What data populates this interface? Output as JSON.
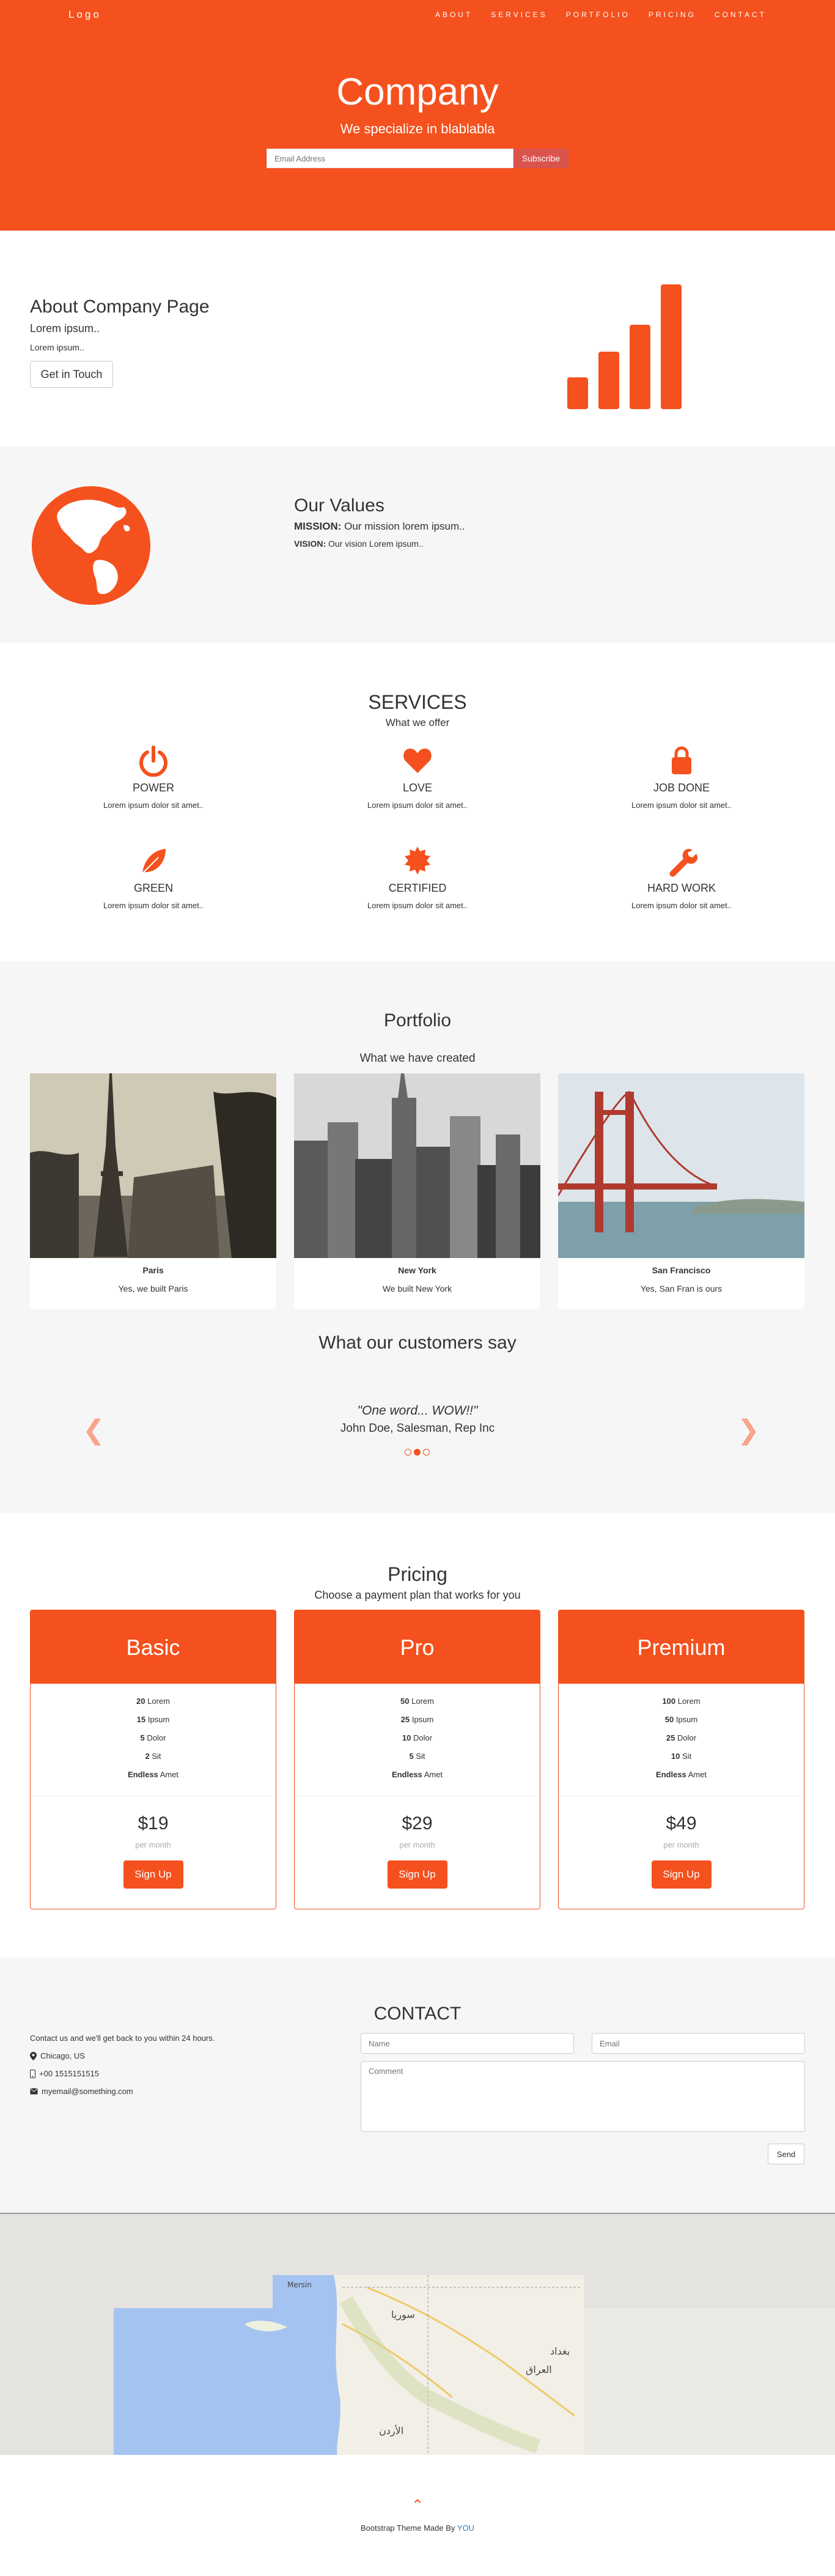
{
  "nav": {
    "logo": "Logo",
    "links": [
      "ABOUT",
      "SERVICES",
      "PORTFOLIO",
      "PRICING",
      "CONTACT"
    ]
  },
  "jumbotron": {
    "title": "Company",
    "tagline": "We specialize in blablabla",
    "email_placeholder": "Email Address",
    "subscribe_label": "Subscribe"
  },
  "about": {
    "title": "About Company Page",
    "lead": "Lorem ipsum..",
    "text": "Lorem ipsum..",
    "button_label": "Get in Touch",
    "icon": "signal-icon"
  },
  "values": {
    "icon": "globe-icon",
    "title": "Our Values",
    "mission_label": "MISSION:",
    "mission_text": " Our mission lorem ipsum..",
    "vision_label": "VISION:",
    "vision_text": " Our vision Lorem ipsum.."
  },
  "services": {
    "title": "SERVICES",
    "subtitle": "What we offer",
    "items": [
      {
        "icon": "power-icon",
        "title": "POWER",
        "text": "Lorem ipsum dolor sit amet.."
      },
      {
        "icon": "heart-icon",
        "title": "LOVE",
        "text": "Lorem ipsum dolor sit amet.."
      },
      {
        "icon": "lock-icon",
        "title": "JOB DONE",
        "text": "Lorem ipsum dolor sit amet.."
      },
      {
        "icon": "leaf-icon",
        "title": "GREEN",
        "text": "Lorem ipsum dolor sit amet.."
      },
      {
        "icon": "certificate-icon",
        "title": "CERTIFIED",
        "text": "Lorem ipsum dolor sit amet.."
      },
      {
        "icon": "wrench-icon",
        "title": "HARD WORK",
        "text": "Lorem ipsum dolor sit amet.."
      }
    ]
  },
  "portfolio": {
    "title": "Portfolio",
    "subtitle": "What we have created",
    "items": [
      {
        "city": "Paris",
        "caption": "Yes, we built Paris"
      },
      {
        "city": "New York",
        "caption": "We built New York"
      },
      {
        "city": "San Francisco",
        "caption": "Yes, San Fran is ours"
      }
    ]
  },
  "testimonials": {
    "title": "What our customers say",
    "quote": "\"One word... WOW!!\"",
    "author": "John Doe, Salesman, Rep Inc",
    "prev_icon": "chevron-left-icon",
    "next_icon": "chevron-right-icon",
    "active_slide": 2,
    "slide_count": 3
  },
  "pricing": {
    "title": "Pricing",
    "subtitle": "Choose a payment plan that works for you",
    "plans": [
      {
        "name": "Basic",
        "features": [
          [
            "20",
            " Lorem"
          ],
          [
            "15",
            " Ipsum"
          ],
          [
            "5",
            " Dolor"
          ],
          [
            "2",
            " Sit"
          ],
          [
            "Endless",
            " Amet"
          ]
        ],
        "price": "$19",
        "per": "per month",
        "button": "Sign Up"
      },
      {
        "name": "Pro",
        "features": [
          [
            "50",
            " Lorem"
          ],
          [
            "25",
            " Ipsum"
          ],
          [
            "10",
            " Dolor"
          ],
          [
            "5",
            " Sit"
          ],
          [
            "Endless",
            " Amet"
          ]
        ],
        "price": "$29",
        "per": "per month",
        "button": "Sign Up"
      },
      {
        "name": "Premium",
        "features": [
          [
            "100",
            " Lorem"
          ],
          [
            "50",
            " Ipsum"
          ],
          [
            "25",
            " Dolor"
          ],
          [
            "10",
            " Sit"
          ],
          [
            "Endless",
            " Amet"
          ]
        ],
        "price": "$49",
        "per": "per month",
        "button": "Sign Up"
      }
    ]
  },
  "contact": {
    "title": "CONTACT",
    "intro": "Contact us and we'll get back to you within 24 hours.",
    "location": "Chicago, US",
    "phone": "+00 1515151515",
    "email": "myemail@something.com",
    "name_placeholder": "Name",
    "email_placeholder": "Email",
    "comment_placeholder": "Comment",
    "send_label": "Send"
  },
  "map": {
    "labels": [
      "Mersin",
      "سوريا",
      "العراق",
      "بغداد",
      "الأردن"
    ]
  },
  "footer": {
    "up_icon": "chevron-up-icon",
    "text": "Bootstrap Theme Made By ",
    "link": "YOU"
  },
  "colors": {
    "accent": "#f4511e",
    "light_bg": "#f6f6f6",
    "danger": "#d9534f"
  }
}
